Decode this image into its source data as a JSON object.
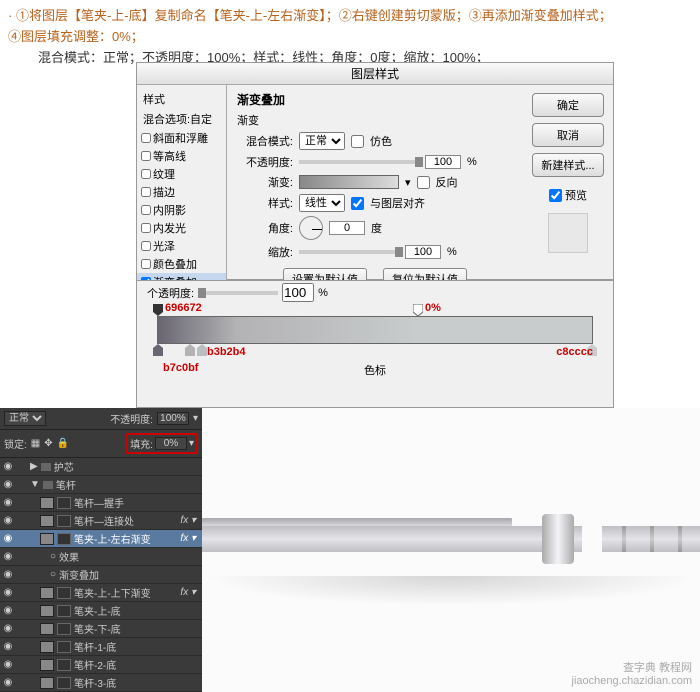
{
  "instructions": {
    "line1": "· ①将图层【笔夹-上-底】复制命名【笔夹-上-左右渐变】；②右键创建剪切蒙版；③再添加渐变叠加样式；",
    "line1b": "④图层填充调整：0%；",
    "line2": "混合模式：正常；不透明度：100%；样式：线性；角度：0度；缩放：100%；"
  },
  "dialog": {
    "title": "图层样式",
    "styles_label": "样式",
    "blend_label": "混合选项:自定",
    "items": [
      "斜面和浮雕",
      "等高线",
      "纹理",
      "描边",
      "内阴影",
      "内发光",
      "光泽",
      "颜色叠加",
      "渐变叠加"
    ],
    "selected_index": 8,
    "section_title": "渐变叠加",
    "section_sub": "渐变",
    "blend_mode": {
      "label": "混合模式:",
      "value": "正常"
    },
    "dither": "仿色",
    "opacity": {
      "label": "不透明度:",
      "value": "100",
      "unit": "%"
    },
    "gradient_label": "渐变:",
    "reverse": "反向",
    "style": {
      "label": "样式:",
      "value": "线性"
    },
    "align": "与图层对齐",
    "angle": {
      "label": "角度:",
      "value": "0",
      "unit": "度"
    },
    "scale": {
      "label": "缩放:",
      "value": "100",
      "unit": "%"
    },
    "set_default": "设置为默认值",
    "reset_default": "复位为默认值",
    "ok": "确定",
    "cancel": "取消",
    "new_style": "新建样式...",
    "preview": "预览"
  },
  "grad": {
    "opacity_label": "个透明度:",
    "opacity_val": "100",
    "section": "色标",
    "annot_tl": "696672",
    "annot_bl": "b3b2b4",
    "annot_bl2": "b7c0bf",
    "annot_tr": "0%",
    "annot_br": "c8cccc"
  },
  "layers": {
    "blend": "正常",
    "opacity_label": "不透明度:",
    "opacity_val": "100%",
    "lock_label": "锁定:",
    "fill_label": "填充:",
    "fill_val": "0%",
    "rows": [
      {
        "eye": "◉",
        "indent": 1,
        "folder": true,
        "name": "护芯"
      },
      {
        "eye": "◉",
        "indent": 1,
        "folder": true,
        "open": true,
        "name": "笔杆"
      },
      {
        "eye": "◉",
        "indent": 2,
        "name": "笔杆—握手"
      },
      {
        "eye": "◉",
        "indent": 2,
        "name": "笔杆—连接处",
        "fx": true
      },
      {
        "eye": "◉",
        "indent": 2,
        "sel": true,
        "name": "笔夹-上-左右渐变",
        "fx": true
      },
      {
        "eye": "◉",
        "indent": 3,
        "name": "效果",
        "nothumb": true
      },
      {
        "eye": "◉",
        "indent": 3,
        "name": "渐变叠加",
        "nothumb": true
      },
      {
        "eye": "◉",
        "indent": 2,
        "name": "笔夹-上-上下渐变",
        "fx": true
      },
      {
        "eye": "◉",
        "indent": 2,
        "name": "笔夹-上-底"
      },
      {
        "eye": "◉",
        "indent": 2,
        "name": "笔夹-下-底"
      },
      {
        "eye": "◉",
        "indent": 2,
        "name": "笔杆-1-底"
      },
      {
        "eye": "◉",
        "indent": 2,
        "name": "笔杆-2-底"
      },
      {
        "eye": "◉",
        "indent": 2,
        "name": "笔杆-3-底"
      }
    ]
  },
  "watermark": {
    "name": "查字典 教程网",
    "url": "jiaocheng.chazidian.com"
  }
}
